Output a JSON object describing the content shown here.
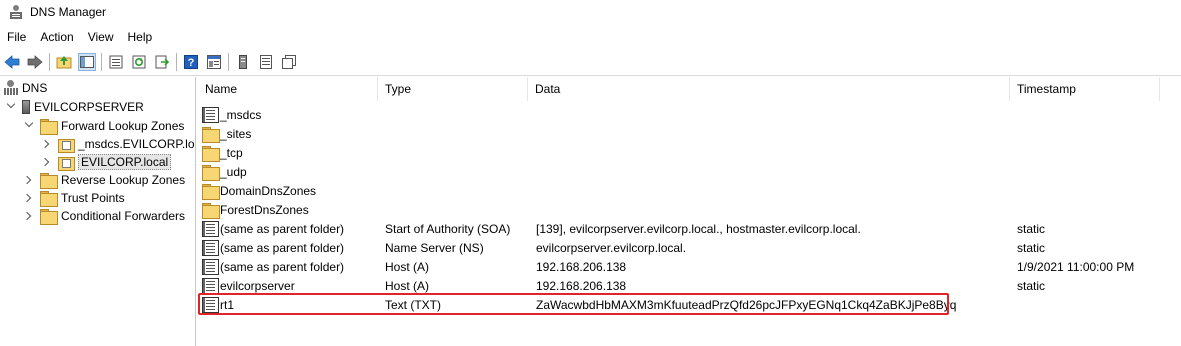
{
  "window": {
    "title": "DNS Manager"
  },
  "menu": [
    "File",
    "Action",
    "View",
    "Help"
  ],
  "toolbar": {
    "icons": [
      "back-arrow-icon",
      "forward-arrow-icon",
      "up-folder-icon",
      "show-hide-tree-icon",
      "properties-icon",
      "refresh-icon",
      "export-list-icon",
      "help-icon",
      "mmc-icon",
      "server-icon",
      "server-list-icon",
      "copy-icon"
    ]
  },
  "tree": {
    "root": "DNS",
    "server": "EVILCORPSERVER",
    "forward_zones": "Forward Lookup Zones",
    "msdcs_zone": "_msdcs.EVILCORP.loc",
    "evilcorp_zone": "EVILCORP.local",
    "reverse_zones": "Reverse Lookup Zones",
    "trust_points": "Trust Points",
    "conditional_forwarders": "Conditional Forwarders"
  },
  "columns": {
    "name": "Name",
    "type": "Type",
    "data": "Data",
    "timestamp": "Timestamp"
  },
  "records": [
    {
      "name": "_msdcs",
      "type": "",
      "data": "",
      "timestamp": "",
      "icon": "record-icon"
    },
    {
      "name": "_sites",
      "type": "",
      "data": "",
      "timestamp": "",
      "icon": "folder-icon"
    },
    {
      "name": "_tcp",
      "type": "",
      "data": "",
      "timestamp": "",
      "icon": "folder-icon"
    },
    {
      "name": "_udp",
      "type": "",
      "data": "",
      "timestamp": "",
      "icon": "folder-icon"
    },
    {
      "name": "DomainDnsZones",
      "type": "",
      "data": "",
      "timestamp": "",
      "icon": "folder-icon"
    },
    {
      "name": "ForestDnsZones",
      "type": "",
      "data": "",
      "timestamp": "",
      "icon": "folder-icon"
    },
    {
      "name": "(same as parent folder)",
      "type": "Start of Authority (SOA)",
      "data": "[139], evilcorpserver.evilcorp.local., hostmaster.evilcorp.local.",
      "timestamp": "static",
      "icon": "record-icon"
    },
    {
      "name": "(same as parent folder)",
      "type": "Name Server (NS)",
      "data": "evilcorpserver.evilcorp.local.",
      "timestamp": "static",
      "icon": "record-icon"
    },
    {
      "name": "(same as parent folder)",
      "type": "Host (A)",
      "data": "192.168.206.138",
      "timestamp": "1/9/2021 11:00:00 PM",
      "icon": "record-icon"
    },
    {
      "name": "evilcorpserver",
      "type": "Host (A)",
      "data": "192.168.206.138",
      "timestamp": "static",
      "icon": "record-icon"
    },
    {
      "name": "rt1",
      "type": "Text (TXT)",
      "data": "ZaWacwbdHbMAXM3mKfuuteadPrzQfd26pcJFPxyEGNq1Ckq4ZaBKJjPe8Byq",
      "timestamp": "",
      "icon": "record-icon"
    }
  ],
  "highlight_color": "#e0242a"
}
